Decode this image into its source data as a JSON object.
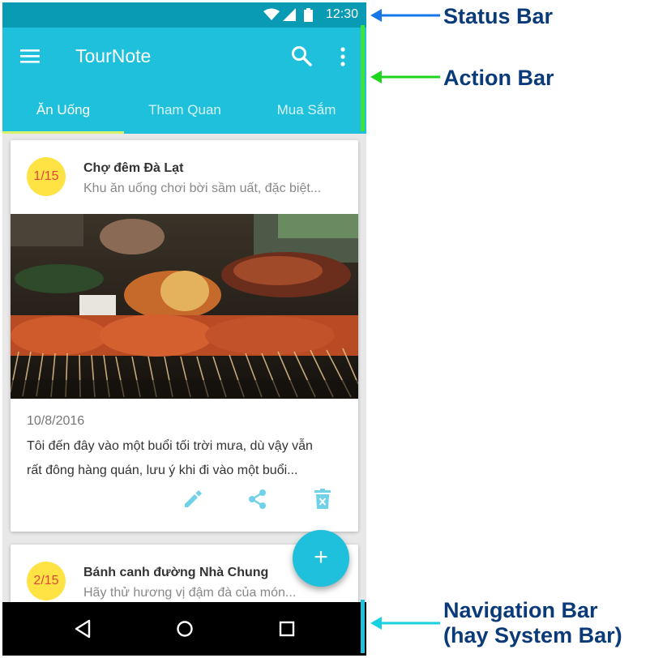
{
  "status_bar": {
    "time": "12:30"
  },
  "action_bar": {
    "title": "TourNote"
  },
  "tabs": [
    {
      "label": "Ăn Uống"
    },
    {
      "label": "Tham Quan"
    },
    {
      "label": "Mua Sắm"
    }
  ],
  "cards": [
    {
      "badge": "1/15",
      "title": "Chợ đêm Đà Lạt",
      "subtitle": "Khu ăn uống chơi bời sầm uất, đặc biệt...",
      "date": "10/8/2016",
      "description_line1": "Tôi đến đây vào một buổi tối trời mưa, dù vậy vẫn",
      "description_line2": "rất đông hàng quán, lưu ý khi đi vào một buổi..."
    },
    {
      "badge": "2/15",
      "title": "Bánh canh đường Nhà Chung",
      "subtitle": "Hãy thử hương vị đậm đà của món..."
    }
  ],
  "fab": {
    "label": "+"
  },
  "annotations": {
    "status_bar": "Status Bar",
    "action_bar": "Action Bar",
    "navigation_bar_line1": "Navigation Bar",
    "navigation_bar_line2": "(hay System Bar)"
  },
  "colors": {
    "status_bar": "#0a9bb4",
    "primary": "#1ec0dc",
    "tab_indicator": "#d7f36a",
    "badge_bg": "#ffe344",
    "badge_text": "#e0473a",
    "arrow_status": "#1677e6",
    "arrow_action": "#1fd61f",
    "arrow_nav": "#18d0e0",
    "annotation_text": "#0b3a78"
  },
  "icons": [
    "wifi-icon",
    "signal-icon",
    "battery-icon",
    "menu-icon",
    "search-icon",
    "more-vert-icon",
    "edit-icon",
    "share-icon",
    "delete-icon",
    "back-icon",
    "home-icon",
    "recents-icon"
  ]
}
